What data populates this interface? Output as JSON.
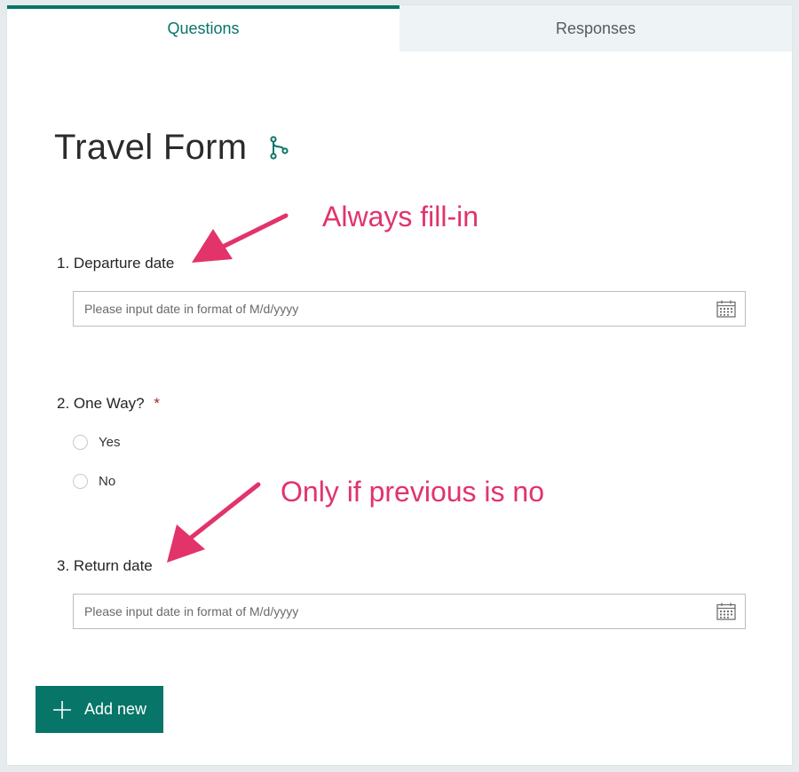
{
  "tabs": {
    "questions": "Questions",
    "responses": "Responses"
  },
  "form": {
    "title": "Travel Form"
  },
  "questions": [
    {
      "number": "1.",
      "label": "Departure date",
      "placeholder": "Please input date in format of M/d/yyyy"
    },
    {
      "number": "2.",
      "label": "One Way?",
      "required_mark": "*",
      "options": [
        "Yes",
        "No"
      ]
    },
    {
      "number": "3.",
      "label": "Return date",
      "placeholder": "Please input date in format of M/d/yyyy"
    }
  ],
  "annotations": {
    "first": "Always fill-in",
    "second": "Only if previous is no"
  },
  "add_button": {
    "label": "Add new"
  },
  "icons": {
    "branching": "branch-icon",
    "calendar": "calendar-icon",
    "add": "plus-icon"
  },
  "colors": {
    "accent": "#077568",
    "annotation": "#e2336b",
    "required": "#a4262c"
  }
}
